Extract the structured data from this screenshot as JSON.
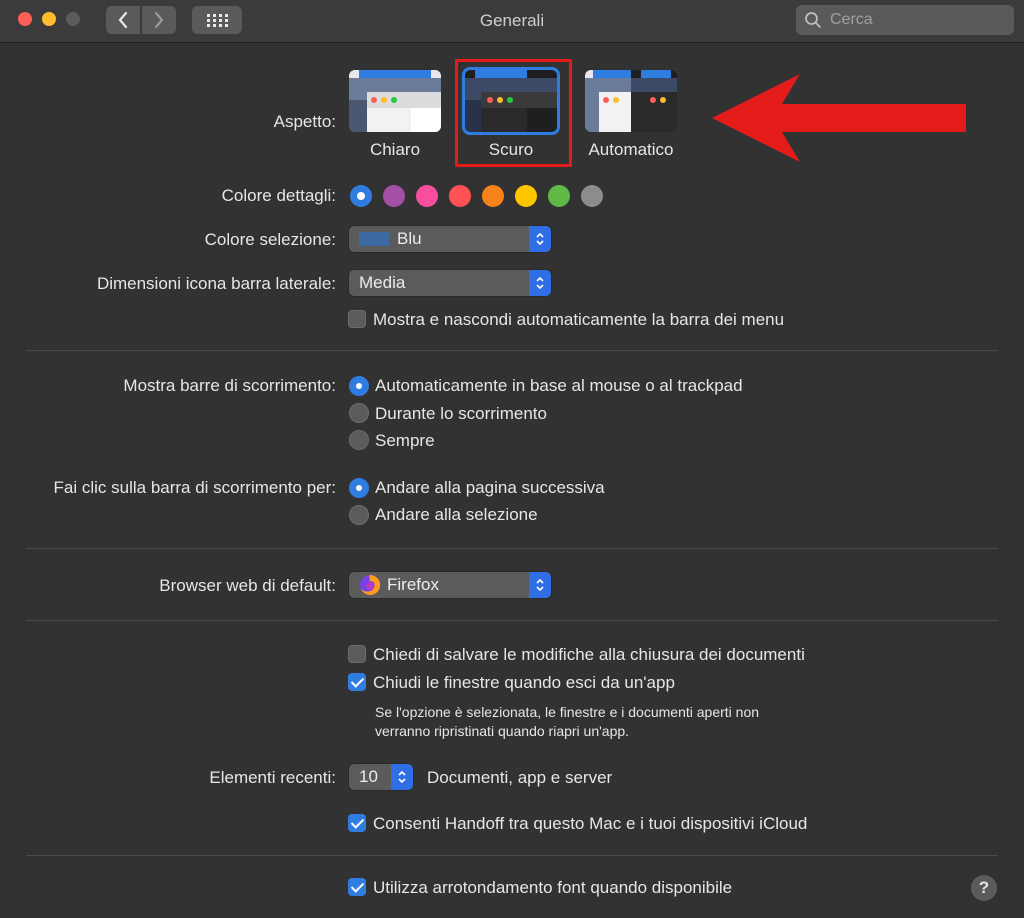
{
  "window": {
    "title": "Generali"
  },
  "search": {
    "placeholder": "Cerca"
  },
  "appearance": {
    "label": "Aspetto:",
    "options": [
      {
        "label": "Chiaro"
      },
      {
        "label": "Scuro",
        "selected": true
      },
      {
        "label": "Automatico"
      }
    ]
  },
  "accent": {
    "label": "Colore dettagli:",
    "colors": [
      "#2f7de1",
      "#a550a7",
      "#f74f9e",
      "#ff5257",
      "#f7821b",
      "#ffc600",
      "#62ba46",
      "#8c8c8c"
    ],
    "selected_index": 0
  },
  "highlight": {
    "label": "Colore selezione:",
    "value": "Blu",
    "swatch_color": "#3d6aa3"
  },
  "sidebar_icon": {
    "label": "Dimensioni icona barra laterale:",
    "value": "Media"
  },
  "menu_bar": {
    "label": "Mostra e nascondi automaticamente la barra dei menu",
    "checked": false
  },
  "scrollbars": {
    "label": "Mostra barre di scorrimento:",
    "options": [
      {
        "label": "Automaticamente in base al mouse o al trackpad",
        "selected": true
      },
      {
        "label": "Durante lo scorrimento",
        "selected": false
      },
      {
        "label": "Sempre",
        "selected": false
      }
    ]
  },
  "click_scroll": {
    "label": "Fai clic sulla barra di scorrimento per:",
    "options": [
      {
        "label": "Andare alla pagina successiva",
        "selected": true
      },
      {
        "label": "Andare alla selezione",
        "selected": false
      }
    ]
  },
  "browser": {
    "label": "Browser web di default:",
    "value": "Firefox"
  },
  "ask_save": {
    "label": "Chiedi di salvare le modifiche alla chiusura dei documenti",
    "checked": false
  },
  "close_windows": {
    "label": "Chiudi le finestre quando esci da un'app",
    "checked": true,
    "note_line1": "Se l'opzione è selezionata, le finestre e i documenti aperti non",
    "note_line2": "verranno ripristinati quando riapri un'app."
  },
  "recent": {
    "label": "Elementi recenti:",
    "value": "10",
    "suffix": "Documenti, app e server"
  },
  "handoff": {
    "label": "Consenti Handoff tra questo Mac e i tuoi dispositivi iCloud",
    "checked": true
  },
  "font_smoothing": {
    "label": "Utilizza arrotondamento font quando disponibile",
    "checked": true
  },
  "help": {
    "label": "?"
  },
  "colors": {
    "accent": "#2f7de1",
    "annotation_red": "#e31b1b"
  }
}
